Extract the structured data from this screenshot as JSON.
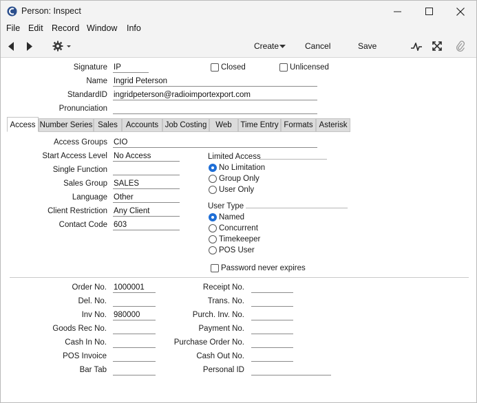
{
  "window": {
    "title": "Person: Inspect"
  },
  "window_controls": {
    "minimize": "—",
    "maximize": "☐",
    "close": "✕"
  },
  "menu": [
    "File",
    "Edit",
    "Record",
    "Window",
    "Info"
  ],
  "toolbar": {
    "create": "Create",
    "cancel": "Cancel",
    "save": "Save"
  },
  "header": {
    "signature_label": "Signature",
    "signature": "IP",
    "name_label": "Name",
    "name": "Ingrid Peterson",
    "standardid_label": "StandardID",
    "standardid": "ingridpeterson@radioimportexport.com",
    "pronunciation_label": "Pronunciation",
    "pronunciation": "",
    "closed_label": "Closed",
    "unlicensed_label": "Unlicensed"
  },
  "tabs": [
    "Access",
    "Number Series",
    "Sales",
    "Accounts",
    "Job Costing",
    "Web",
    "Time Entry",
    "Formats",
    "Asterisk"
  ],
  "access": {
    "access_groups_label": "Access Groups",
    "access_groups": "CIO",
    "start_access_level_label": "Start Access Level",
    "start_access_level": "No Access",
    "single_function_label": "Single Function",
    "single_function": "",
    "sales_group_label": "Sales Group",
    "sales_group": "SALES",
    "language_label": "Language",
    "language": "Other",
    "client_restriction_label": "Client Restriction",
    "client_restriction": "Any Client",
    "contact_code_label": "Contact Code",
    "contact_code": "603",
    "limited_access_title": "Limited Access",
    "limited_access_options": [
      "No Limitation",
      "Group Only",
      "User Only"
    ],
    "limited_access_selected": "No Limitation",
    "user_type_title": "User Type",
    "user_type_options": [
      "Named",
      "Concurrent",
      "Timekeeper",
      "POS User"
    ],
    "user_type_selected": "Named",
    "password_never_expires_label": "Password never expires"
  },
  "numbers_left": [
    {
      "label": "Order No.",
      "value": "1000001"
    },
    {
      "label": "Del. No.",
      "value": ""
    },
    {
      "label": "Inv No.",
      "value": "980000"
    },
    {
      "label": "Goods Rec No.",
      "value": ""
    },
    {
      "label": "Cash In No.",
      "value": ""
    },
    {
      "label": "POS Invoice",
      "value": ""
    },
    {
      "label": "Bar Tab",
      "value": ""
    }
  ],
  "numbers_right": [
    {
      "label": "Receipt No.",
      "value": ""
    },
    {
      "label": "Trans. No.",
      "value": ""
    },
    {
      "label": "Purch. Inv. No.",
      "value": ""
    },
    {
      "label": "Payment No.",
      "value": ""
    },
    {
      "label": "Purchase Order No.",
      "value": ""
    },
    {
      "label": "Cash Out No.",
      "value": ""
    },
    {
      "label": "Personal ID",
      "value": ""
    }
  ],
  "colors": {
    "accent": "#1e6ed6",
    "chrome": "#f3f3f3",
    "tab_inactive": "#dcdcdc"
  },
  "icons": [
    "app-icon",
    "back-arrow-icon",
    "forward-arrow-icon",
    "gear-icon",
    "pulse-icon",
    "expand-icon",
    "paperclip-icon"
  ]
}
